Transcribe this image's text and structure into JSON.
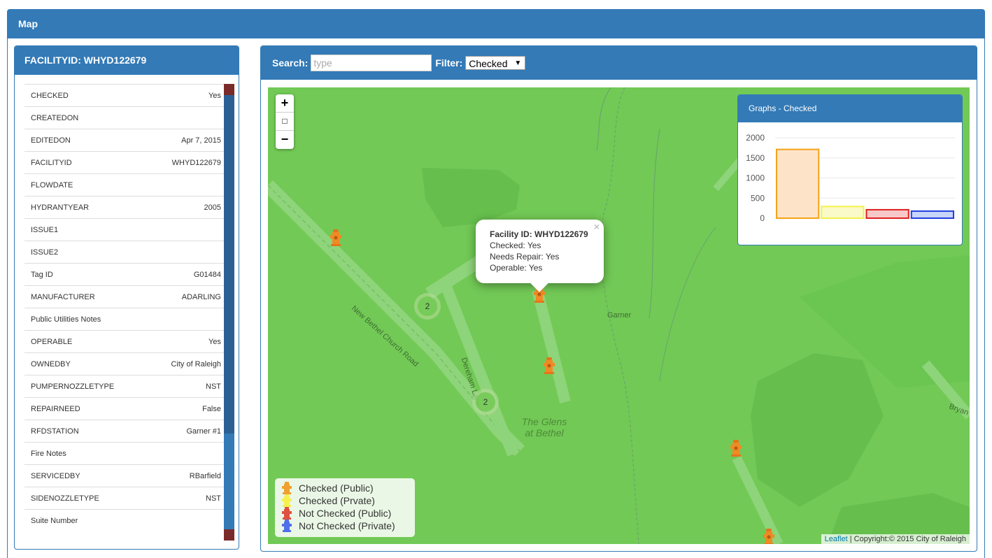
{
  "outer": {
    "title": "Map"
  },
  "left_panel": {
    "title": "FACILITYID: WHYD122679",
    "attributes": [
      {
        "key": "CHECKED",
        "value": "Yes"
      },
      {
        "key": "CREATEDON",
        "value": ""
      },
      {
        "key": "EDITEDON",
        "value": "Apr 7, 2015"
      },
      {
        "key": "FACILITYID",
        "value": "WHYD122679"
      },
      {
        "key": "FLOWDATE",
        "value": ""
      },
      {
        "key": "HYDRANTYEAR",
        "value": "2005"
      },
      {
        "key": "ISSUE1",
        "value": ""
      },
      {
        "key": "ISSUE2",
        "value": ""
      },
      {
        "key": "Tag ID",
        "value": "G01484"
      },
      {
        "key": "MANUFACTURER",
        "value": "ADARLING"
      },
      {
        "key": "Public Utilities Notes",
        "value": ""
      },
      {
        "key": "OPERABLE",
        "value": "Yes"
      },
      {
        "key": "OWNEDBY",
        "value": "City of Raleigh"
      },
      {
        "key": "PUMPERNOZZLETYPE",
        "value": "NST"
      },
      {
        "key": "REPAIRNEED",
        "value": "False"
      },
      {
        "key": "RFDSTATION",
        "value": "Garner #1"
      },
      {
        "key": "Fire Notes",
        "value": ""
      },
      {
        "key": "SERVICEDBY",
        "value": "RBarfield"
      },
      {
        "key": "SIDENOZZLETYPE",
        "value": "NST"
      },
      {
        "key": "Suite Number",
        "value": ""
      }
    ]
  },
  "toolbar": {
    "search_label": "Search:",
    "search_placeholder": "type",
    "filter_label": "Filter:",
    "filter_value": "Checked"
  },
  "map": {
    "zoom_in": "+",
    "zoom_box": "□",
    "zoom_out": "−",
    "popup": {
      "title": "Facility ID: WHYD122679",
      "close": "×",
      "lines": [
        "Checked: Yes",
        "Needs Repair: Yes",
        "Operable: Yes"
      ]
    },
    "clusters": [
      "2",
      "2"
    ],
    "place_label": "The Glens\nat Bethel",
    "road_labels": [
      "New Bethel Church Road",
      "Dereham Lane",
      "Garner",
      "Bryan"
    ],
    "legend": [
      {
        "label": "Checked (Public)",
        "color": "#f0a030"
      },
      {
        "label": "Checked (Prvate)",
        "color": "#f5f050"
      },
      {
        "label": "Not Checked (Public)",
        "color": "#e05040"
      },
      {
        "label": "Not Checked (Private)",
        "color": "#5070e8"
      }
    ],
    "attribution_link": "Leaflet",
    "attribution_text": " | Copyright:© 2015 City of Raleigh"
  },
  "graph": {
    "title": "Graphs - Checked",
    "chart_data": {
      "type": "bar",
      "categories": [
        "Checked (Public)",
        "Checked (Private)",
        "Not Checked (Public)",
        "Not Checked (Private)"
      ],
      "values": [
        1710,
        290,
        210,
        175
      ],
      "ylim": [
        0,
        2000
      ],
      "yticks": [
        0,
        500,
        1000,
        1500,
        2000
      ],
      "fills": [
        "#fde4c8",
        "#fafac8",
        "#f8c8c8",
        "#c8d4f8"
      ],
      "strokes": [
        "#f5a31a",
        "#f2f24a",
        "#e02020",
        "#2040e0"
      ]
    }
  }
}
